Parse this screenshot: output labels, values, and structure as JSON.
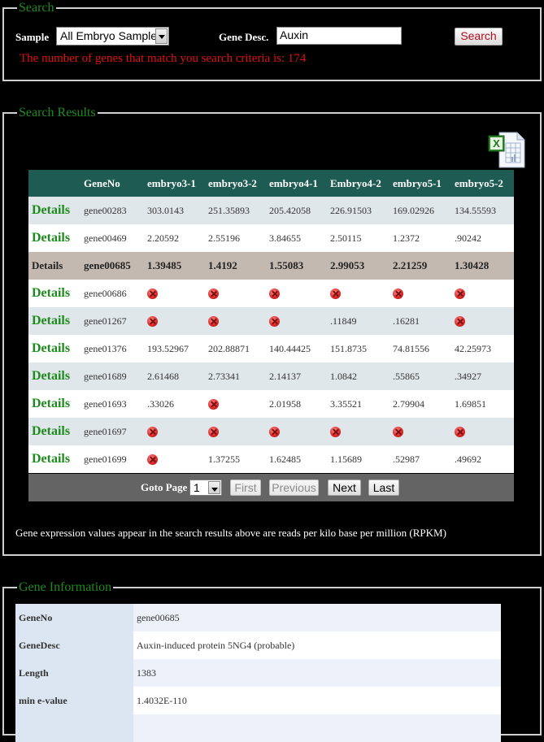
{
  "search": {
    "legend": "Search",
    "sample_label": "Sample",
    "sample_selected": "All Embryo Sample",
    "gene_desc_label": "Gene Desc.",
    "gene_desc_value": "Auxin",
    "search_button": "Search",
    "match_message": "The number of genes that match you search criteria is: 174"
  },
  "results": {
    "legend": "Search Results",
    "export_icon": "excel-export-icon",
    "columns": [
      "",
      "GeneNo",
      "embryo3-1",
      "embryo3-2",
      "embryo4-1",
      "Embryo4-2",
      "embryo5-1",
      "embryo5-2"
    ],
    "details_label": "Details",
    "missing_icon": "red-x-circle-icon",
    "rows": [
      {
        "gene": "gene00283",
        "values": [
          "303.0143",
          "251.35893",
          "205.42058",
          "226.91503",
          "169.02926",
          "134.55593"
        ]
      },
      {
        "gene": "gene00469",
        "values": [
          "2.20592",
          "2.55196",
          "3.84655",
          "2.50115",
          "1.2372",
          ".90242"
        ]
      },
      {
        "gene": "gene00685",
        "values": [
          "1.39485",
          "1.4192",
          "1.55083",
          "2.99053",
          "2.21259",
          "1.30428"
        ],
        "selected": true
      },
      {
        "gene": "gene00686",
        "values": [
          null,
          null,
          null,
          null,
          null,
          null
        ]
      },
      {
        "gene": "gene01267",
        "values": [
          null,
          null,
          null,
          ".11849",
          ".16281",
          null
        ]
      },
      {
        "gene": "gene01376",
        "values": [
          "193.52967",
          "202.88871",
          "140.44425",
          "151.8735",
          "74.81556",
          "42.25973"
        ]
      },
      {
        "gene": "gene01689",
        "values": [
          "2.61468",
          "2.73341",
          "2.14137",
          "1.0842",
          ".55865",
          ".34927"
        ]
      },
      {
        "gene": "gene01693",
        "values": [
          ".33026",
          null,
          "2.01958",
          "3.35521",
          "2.79904",
          "1.69851"
        ]
      },
      {
        "gene": "gene01697",
        "values": [
          null,
          null,
          null,
          null,
          null,
          null
        ]
      },
      {
        "gene": "gene01699",
        "values": [
          null,
          "1.37255",
          "1.62485",
          "1.15689",
          ".52987",
          ".49692"
        ]
      }
    ],
    "pager": {
      "goto_label": "Goto Page",
      "page_selected": "1",
      "first": "First",
      "previous": "Previous",
      "next": "Next",
      "last": "Last"
    },
    "note": "Gene expression values appear in the search results above are reads per kilo base per million (RPKM)"
  },
  "gene_info": {
    "legend": "Gene Information",
    "fields": [
      {
        "key": "GeneNo",
        "value": "gene00685"
      },
      {
        "key": "GeneDesc",
        "value": "Auxin-induced protein 5NG4 (probable)"
      },
      {
        "key": "Length",
        "value": "1383"
      },
      {
        "key": "min e-value",
        "value": "1.4032E-110"
      },
      {
        "key": "",
        "value": ""
      }
    ]
  },
  "colors": {
    "legend_green": "#1f8a1f",
    "header_teal": "#1e5b53",
    "selected_row": "#c4b9b0",
    "alert_red": "#e01010",
    "pager_gray": "#646464"
  }
}
